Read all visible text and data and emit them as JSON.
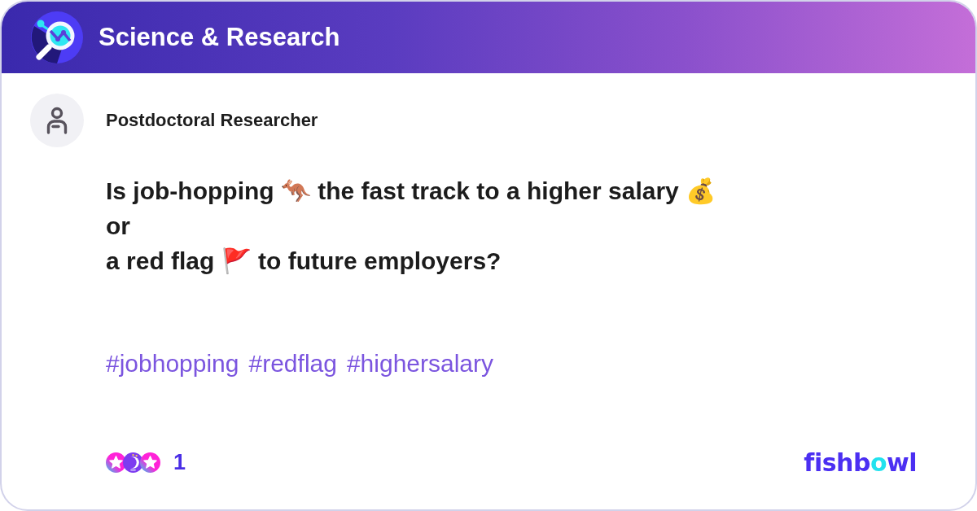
{
  "header": {
    "title": "Science & Research"
  },
  "post": {
    "author": "Postdoctoral Researcher",
    "title": "Is job-hopping 🦘 the fast track to a higher salary 💰\nor\na red flag 🚩 to future employers?",
    "hashtags": [
      "#jobhopping",
      "#redflag",
      "#highersalary"
    ]
  },
  "footer": {
    "reaction_count": "1",
    "logo": [
      {
        "text": "fishb",
        "kind": "plain"
      },
      {
        "text": "o",
        "kind": "accent"
      },
      {
        "text": "wl",
        "kind": "plain"
      }
    ]
  }
}
